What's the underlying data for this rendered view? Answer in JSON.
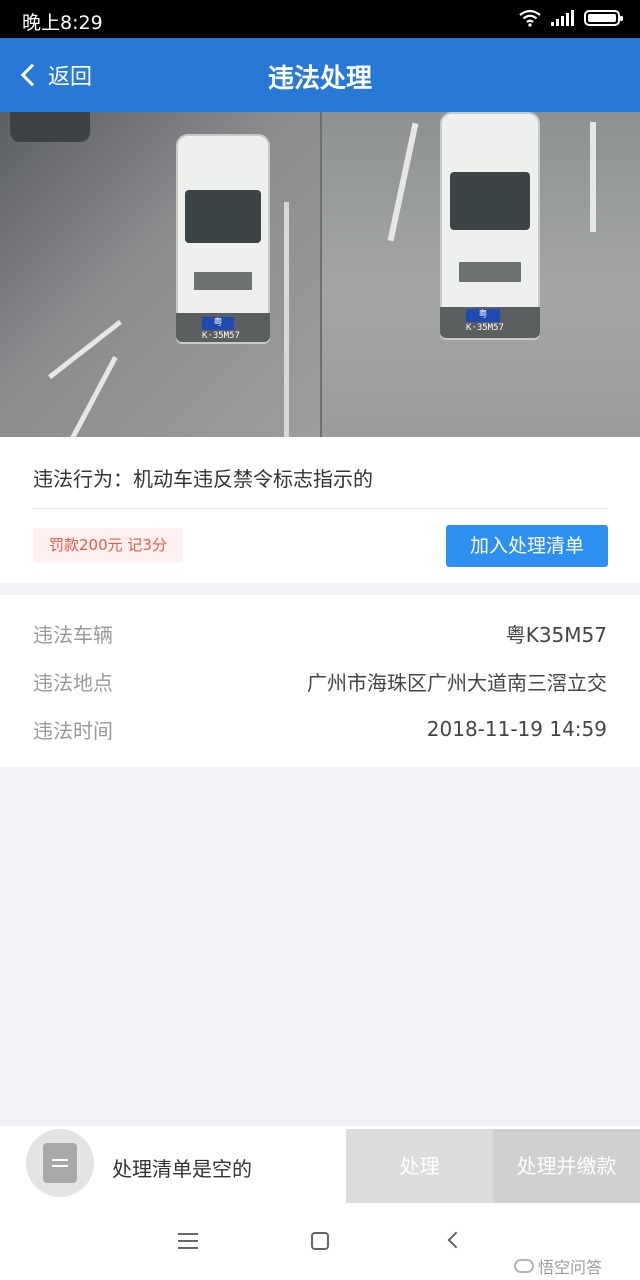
{
  "status_bar": {
    "time": "晚上8:29"
  },
  "header": {
    "back_label": "返回",
    "title": "违法处理"
  },
  "violation": {
    "behavior": "违法行为：机动车违反禁令标志指示的",
    "fine_tag": "罚款200元 记3分",
    "add_button": "加入处理清单",
    "photo_plates": [
      "粤K·35M57",
      "粤K·35M57"
    ]
  },
  "details": [
    {
      "key": "违法车辆",
      "value": "粤K35M57"
    },
    {
      "key": "违法地点",
      "value": "广州市海珠区广州大道南三滘立交"
    },
    {
      "key": "违法时间",
      "value": "2018-11-19 14:59"
    }
  ],
  "bottom_bar": {
    "empty_text": "处理清单是空的",
    "process_button": "处理",
    "pay_button": "处理并缴款"
  },
  "watermark": "悟空问答"
}
